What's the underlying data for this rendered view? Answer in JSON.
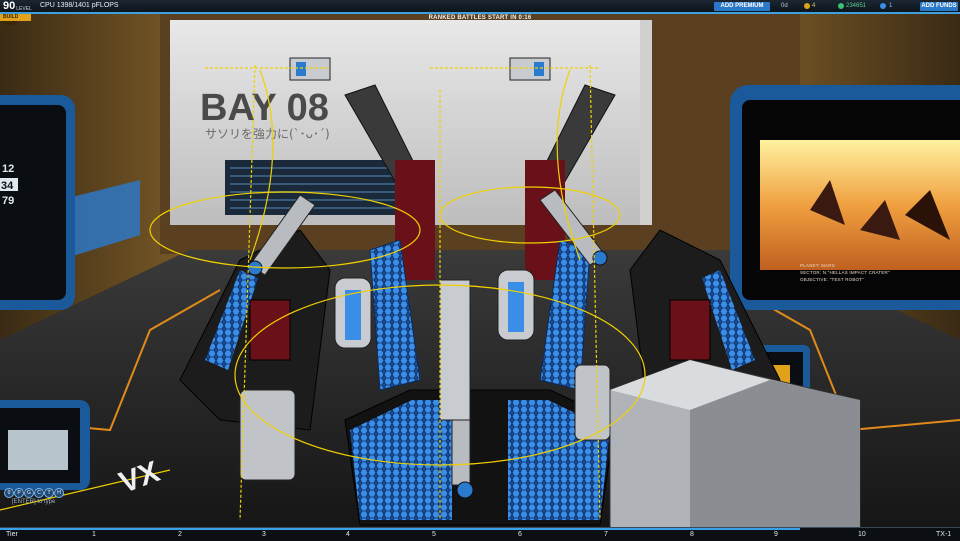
{
  "hud": {
    "level": "90",
    "level_label": "LEVEL",
    "cpu": "CPU 1398/1401 pFLOPS",
    "ranked_banner": "RANKED BATTLES START IN 0:16",
    "add_premium": "ADD PREMIUM",
    "premium_days": "0d",
    "tokens": "4",
    "robits": "234651",
    "cosmetic": "1",
    "add_funds": "ADD FUNDS",
    "build_tag": "BUILD TERR"
  },
  "bay_sign": {
    "title": "BAY 08",
    "subtitle": "サソリを強力に(`･ᴗ･´)"
  },
  "left_screen": {
    "values": [
      "12",
      "34",
      "79"
    ]
  },
  "planet_info": {
    "planet": "PLANET: MARS",
    "sector": "SECTOR: N.\"HELLAS IMPACT CRATER\"",
    "objective": "OBJECTIVE: \"TEST ROBOT\""
  },
  "chat": {
    "icons": [
      "0",
      "P",
      "G",
      "C",
      "T",
      "H"
    ],
    "input_placeholder": "[ENTER] to type"
  },
  "hotbar": {
    "slots": [
      "Tier",
      "1",
      "2",
      "3",
      "4",
      "5",
      "6",
      "7",
      "8",
      "9",
      "10",
      "TX-1"
    ]
  },
  "colors": {
    "accent": "#2a78c8",
    "gizmo": "#f0d000",
    "armor_blue": "#3a8ee8",
    "armor_red": "#8a1018"
  }
}
